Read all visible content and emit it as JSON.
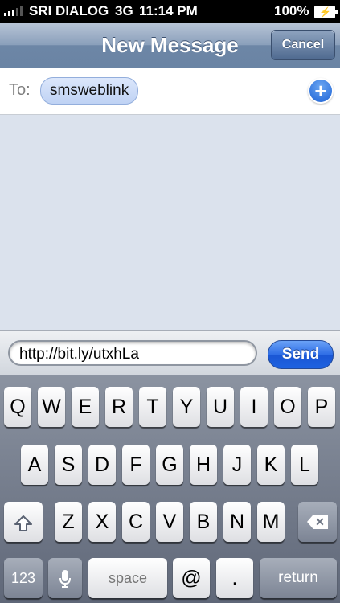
{
  "status_bar": {
    "carrier": "SRI DIALOG",
    "network": "3G",
    "time": "11:14 PM",
    "battery_pct": "100%"
  },
  "nav": {
    "title": "New Message",
    "cancel_label": "Cancel"
  },
  "recipient": {
    "to_label": "To:",
    "chip": "smsweblink"
  },
  "compose": {
    "text": "http://bit.ly/utxhLa",
    "send_label": "Send"
  },
  "keyboard": {
    "row1": [
      "Q",
      "W",
      "E",
      "R",
      "T",
      "Y",
      "U",
      "I",
      "O",
      "P"
    ],
    "row2": [
      "A",
      "S",
      "D",
      "F",
      "G",
      "H",
      "J",
      "K",
      "L"
    ],
    "row3": [
      "Z",
      "X",
      "C",
      "V",
      "B",
      "N",
      "M"
    ],
    "numbers_label": "123",
    "space_label": "space",
    "at_label": "@",
    "dot_label": ".",
    "return_label": "return"
  },
  "icons": {
    "shift": "shift-arrow-icon",
    "delete": "backspace-icon",
    "mic": "microphone-icon",
    "add": "add-contact-icon"
  },
  "colors": {
    "send_blue": "#1e62e0",
    "nav_blue": "#6d86a6",
    "chip_blue": "#bfd2f4",
    "message_bg": "#dbe2ed"
  }
}
